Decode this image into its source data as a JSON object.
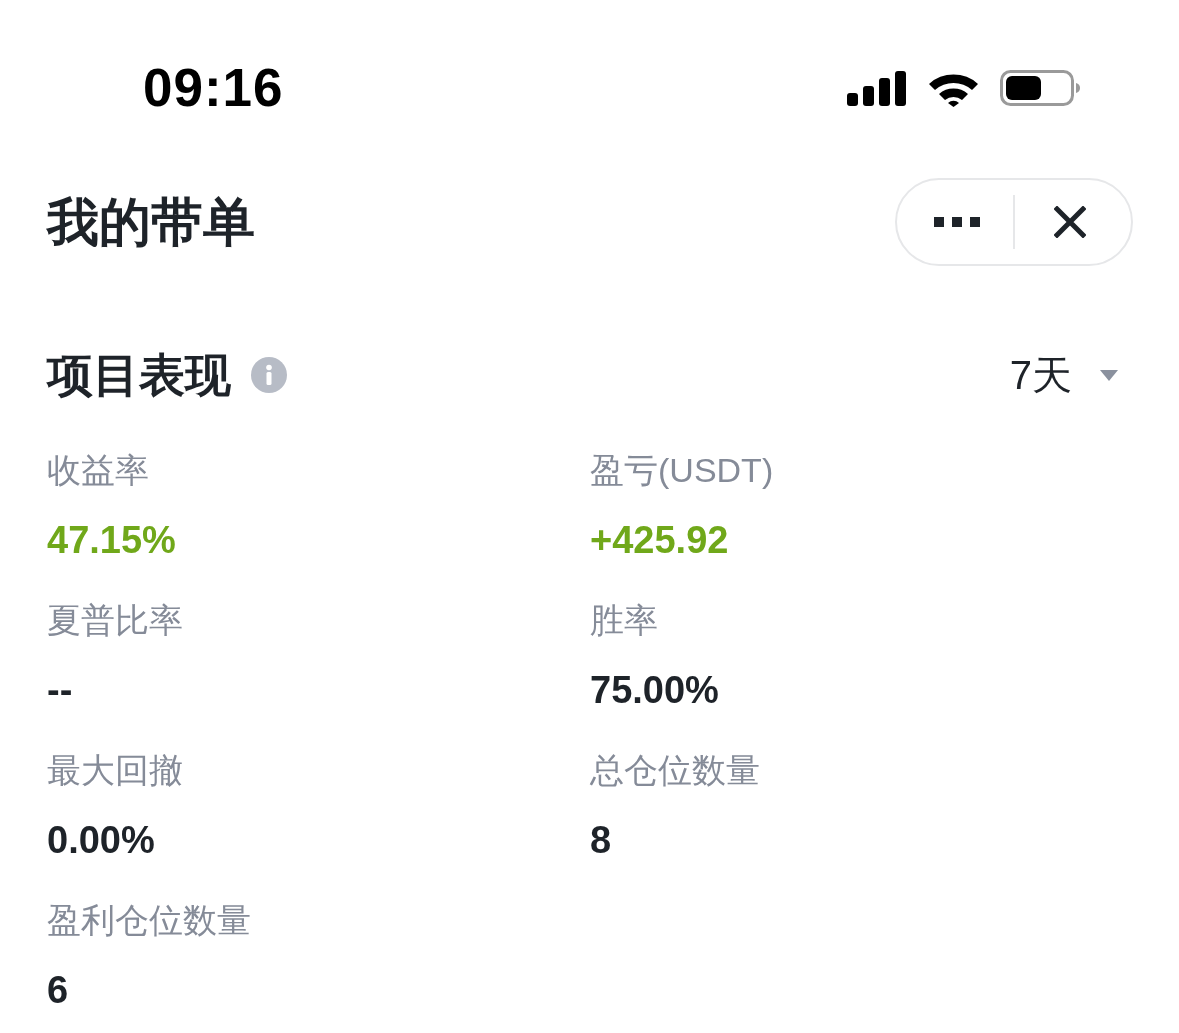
{
  "status_bar": {
    "time": "09:16"
  },
  "header": {
    "title": "我的带单"
  },
  "section": {
    "title": "项目表现",
    "period": "7天"
  },
  "metrics": [
    {
      "label": "收益率",
      "value": "47.15%",
      "kind": "gain"
    },
    {
      "label": "盈亏(USDT)",
      "value": "+425.92",
      "kind": "gain"
    },
    {
      "label": "夏普比率",
      "value": "--",
      "kind": "plain"
    },
    {
      "label": "胜率",
      "value": "75.00%",
      "kind": "plain"
    },
    {
      "label": "最大回撤",
      "value": "0.00%",
      "kind": "plain"
    },
    {
      "label": "总仓位数量",
      "value": "8",
      "kind": "plain"
    },
    {
      "label": "盈利仓位数量",
      "value": "6",
      "kind": "plain"
    }
  ]
}
